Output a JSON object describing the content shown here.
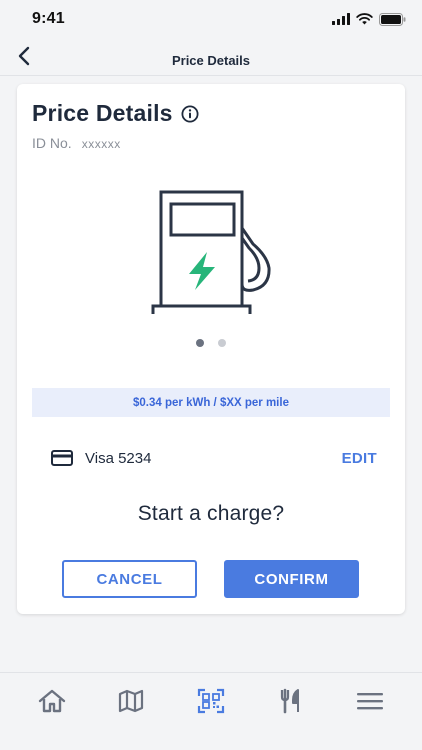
{
  "status_bar": {
    "time": "9:41"
  },
  "header": {
    "title": "Price Details",
    "back_icon": "chevron-left-icon"
  },
  "card": {
    "title": "Price Details",
    "info_icon": "info-icon",
    "id_label": "ID No.",
    "id_value": "xxxxxx",
    "illustration": "ev-charger-icon",
    "carousel": {
      "pages": 2,
      "active": 0
    },
    "price_text": "$0.34 per kWh / $XX per mile",
    "payment": {
      "icon": "credit-card-icon",
      "label": "Visa 5234",
      "edit_label": "EDIT"
    },
    "prompt": "Start a charge?",
    "cancel_label": "CANCEL",
    "confirm_label": "CONFIRM"
  },
  "tab_bar": {
    "items": [
      {
        "name": "home",
        "icon": "home-icon"
      },
      {
        "name": "map",
        "icon": "map-icon"
      },
      {
        "name": "scan",
        "icon": "qr-scan-icon",
        "active": true
      },
      {
        "name": "dining",
        "icon": "fork-knife-icon"
      },
      {
        "name": "menu",
        "icon": "hamburger-menu-icon"
      }
    ]
  },
  "colors": {
    "accent": "#4a7be0",
    "text": "#1f2a3c",
    "bolt": "#27b57a",
    "banner_bg": "#e9eefb",
    "background": "#f3f4f6"
  }
}
